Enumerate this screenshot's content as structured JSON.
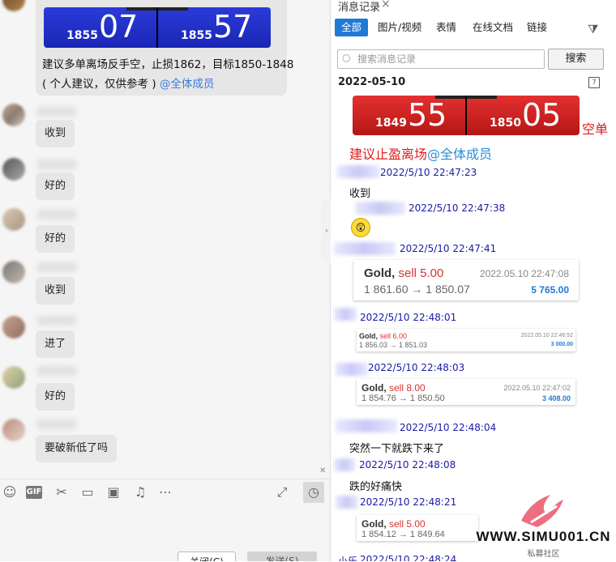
{
  "left_chat": {
    "top_quote": {
      "left_small": "1855",
      "left_big": "07",
      "right_small": "1855",
      "right_big": "57"
    },
    "top_message_line1": "建议多单离场反手空，止损1862，目标1850-1848",
    "top_message_line2_prefix": "( 个人建议，仅供参考 ) ",
    "top_message_mention": "@全体成员",
    "messages": [
      "收到",
      "好的",
      "好的",
      "收到",
      "进了",
      "好的",
      "要破新低了吗"
    ],
    "toolbar_icons": [
      "smile-icon",
      "gif-icon",
      "scissors-icon",
      "folder-icon",
      "image-icon",
      "bell-icon",
      "more-icon",
      "expand-icon",
      "history-icon"
    ],
    "gif_label": "GIF",
    "close_button": "关闭(C)",
    "send_button": "发送(S)"
  },
  "history_panel": {
    "title": "消息记录",
    "tabs": [
      "全部",
      "图片/视频",
      "表情",
      "在线文档",
      "链接"
    ],
    "search_placeholder": "搜索消息记录",
    "search_button": "搜索",
    "date_header": "2022-05-10",
    "calendar_glyph": "7",
    "quote": {
      "left_small": "1849",
      "left_big": "55",
      "right_small": "1850",
      "right_big": "05"
    },
    "short_label": "空单",
    "advice": "建议止盈离场",
    "advice_mention": "@全体成员",
    "entries": [
      {
        "time": "2022/5/10 22:47:23",
        "text": "收到"
      },
      {
        "time": "2022/5/10 22:47:38",
        "text": ""
      },
      {
        "time": "2022/5/10 22:47:41",
        "text": ""
      },
      {
        "time": "2022/5/10 22:48:01",
        "text": ""
      },
      {
        "time": "2022/5/10 22:48:03",
        "text": ""
      },
      {
        "time": "2022/5/10 22:48:04",
        "text": "突然一下就跌下来了"
      },
      {
        "time": "2022/5/10 22:48:08",
        "text": "跌的好痛快"
      },
      {
        "time": "2022/5/10 22:48:21",
        "text": ""
      },
      {
        "time": "2022/5/10 22:48:24",
        "text": ""
      }
    ],
    "last_sender": "小乐",
    "emoji_glyph": "😲",
    "cards": [
      {
        "symbol": "Gold, ",
        "side": "sell 5.00",
        "prices": "1 861.60 → 1 850.07",
        "date": "2022.05.10 22:47:08",
        "amount": "5 765.00"
      },
      {
        "symbol": "Gold, ",
        "side": "sell 6.00",
        "prices": "1 856.03 → 1 851.03",
        "date": "2022.05.10 22:46:52",
        "amount": "3 000.00"
      },
      {
        "symbol": "Gold, ",
        "side": "sell 8.00",
        "prices": "1 854.76 → 1 850.50",
        "date": "2022.05.10 22:47:02",
        "amount": "3 408.00"
      },
      {
        "symbol": "Gold, ",
        "side": "sell 5.00",
        "prices": "1 854.12 → 1 849.64",
        "date": "",
        "amount": ""
      }
    ]
  },
  "watermark": {
    "site": "WWW.SIMU001.CN",
    "sub": "私募社区"
  }
}
